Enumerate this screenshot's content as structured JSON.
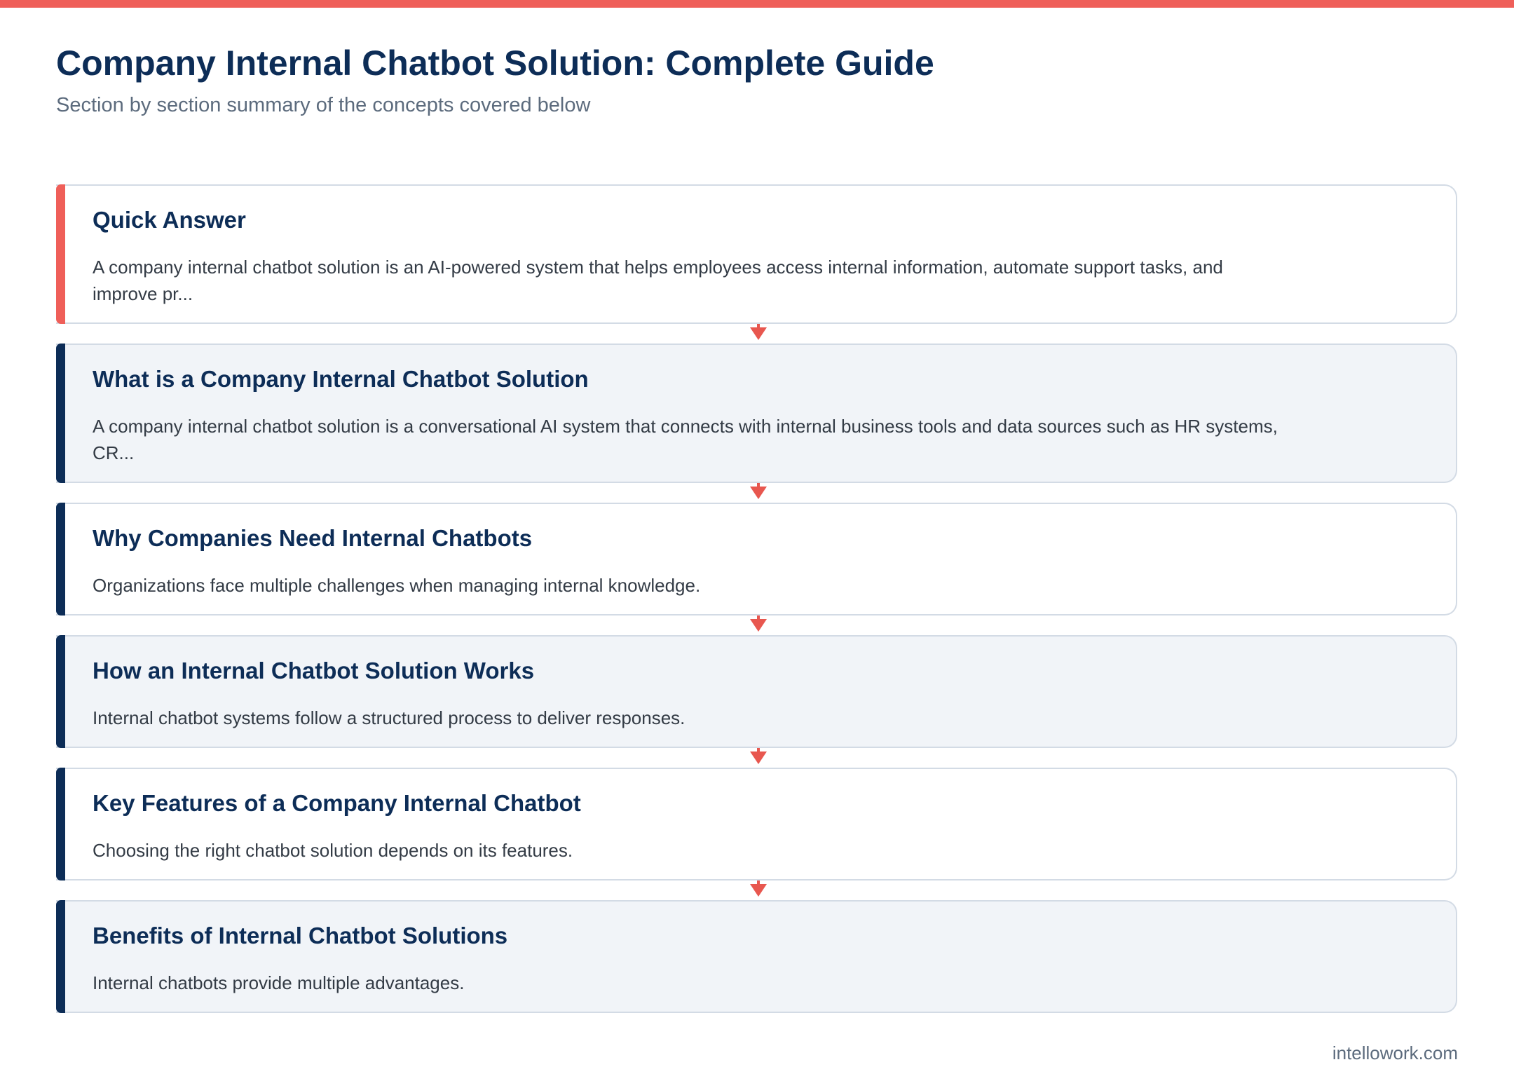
{
  "header": {
    "title": "Company Internal Chatbot Solution: Complete Guide",
    "subtitle": "Section by section summary of the concepts covered below"
  },
  "colors": {
    "top_bar": "#ef5f59",
    "accent_highlight": "#ef5f59",
    "accent_default": "#0d2d57",
    "arrow": "#e8574f",
    "title_text": "#0d2d57"
  },
  "sections": [
    {
      "title": "Quick Answer",
      "text": "A company internal chatbot solution is an AI-powered system that helps employees access internal information, automate support tasks, and improve pr..."
    },
    {
      "title": "What is a Company Internal Chatbot Solution",
      "text": "A company internal chatbot solution is a conversational AI system that connects with internal business tools and data sources such as HR systems, CR..."
    },
    {
      "title": "Why Companies Need Internal Chatbots",
      "text": "Organizations face multiple challenges when managing internal knowledge."
    },
    {
      "title": "How an Internal Chatbot Solution Works",
      "text": "Internal chatbot systems follow a structured process to deliver responses."
    },
    {
      "title": "Key Features of a Company Internal Chatbot",
      "text": "Choosing the right chatbot solution depends on its features."
    },
    {
      "title": "Benefits of Internal Chatbot Solutions",
      "text": "Internal chatbots provide multiple advantages."
    }
  ],
  "footer": {
    "brand": "intellowork.com"
  }
}
